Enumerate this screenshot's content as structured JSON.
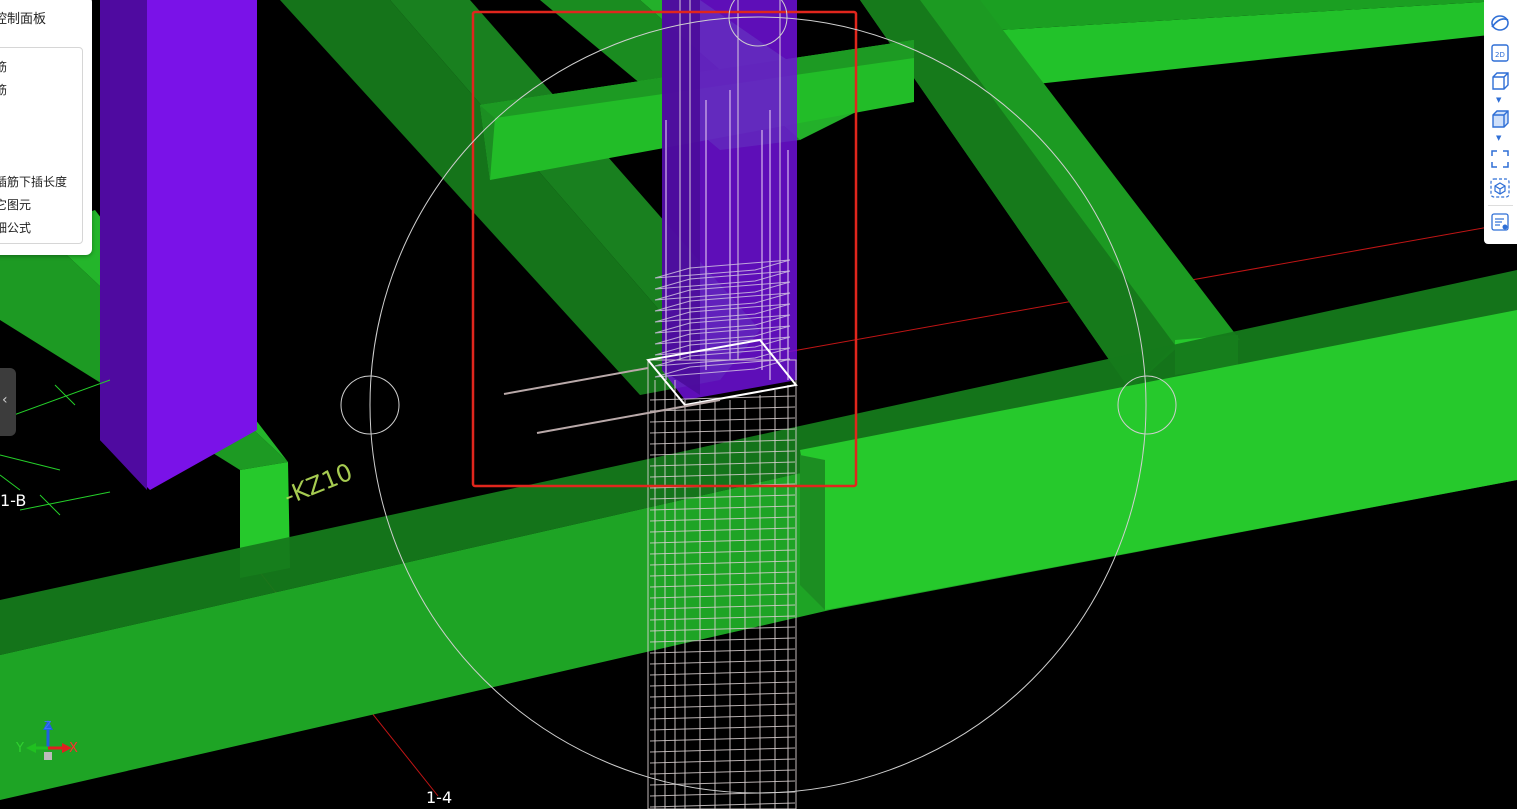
{
  "control_panel": {
    "title": "控制面板",
    "options": [
      "筋",
      "筋",
      "插筋下插长度",
      "它图元",
      "细公式"
    ]
  },
  "collapse_tab": {
    "icon": "chevron-left-icon",
    "glyph": "‹"
  },
  "toolbar": {
    "buttons": [
      {
        "icon": "orbit-icon"
      },
      {
        "icon": "view-2d-icon",
        "label": "2D"
      },
      {
        "icon": "wireframe-cube-icon"
      },
      {
        "icon": "solid-cube-icon"
      },
      {
        "icon": "fullscreen-icon"
      },
      {
        "icon": "box-select-icon"
      },
      {
        "icon": "property-list-icon"
      }
    ]
  },
  "scene": {
    "column_label": "KZ10",
    "column_label_prefix": "-",
    "grid_labels": {
      "left": "1-B",
      "bottom": "1-4"
    },
    "axes": {
      "x": "X",
      "y": "Y",
      "z": "Z"
    },
    "colors": {
      "background": "#000000",
      "beam": "#22c22a",
      "beam_dark": "#157a1a",
      "column": "#7a12e8",
      "rebar": "#d8cfcf",
      "selection_box": "#e0261d",
      "axis_x": "#e02020",
      "axis_y": "#20c020",
      "axis_z": "#2060e0"
    }
  }
}
